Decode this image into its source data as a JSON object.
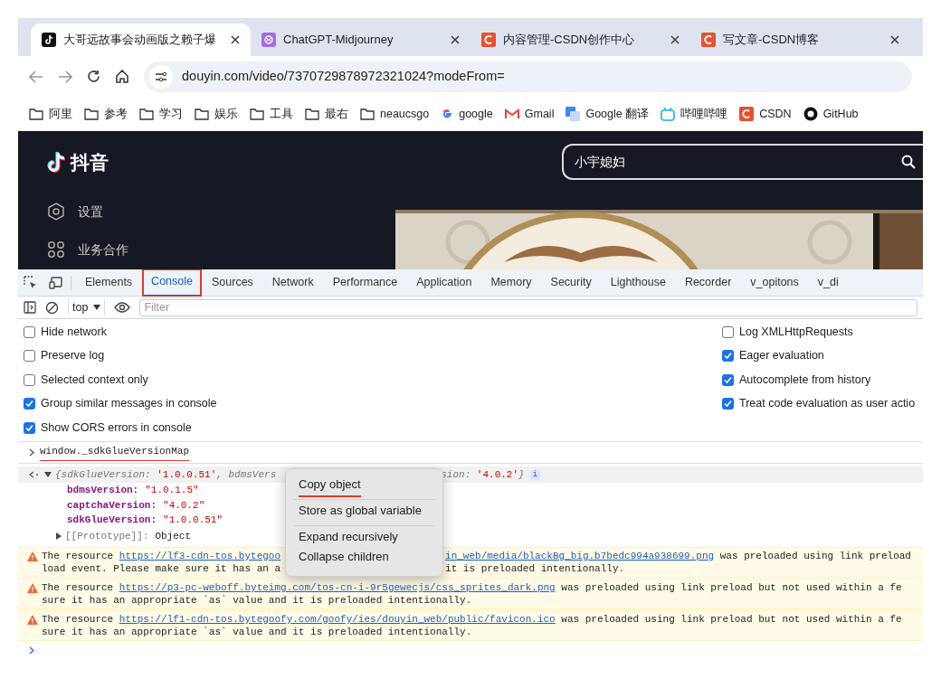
{
  "browser_tabs": [
    {
      "title": "大哥远故事会动画版之赖子爆",
      "kind": "tiktok",
      "selected": true
    },
    {
      "title": "ChatGPT-Midjourney",
      "kind": "chatgpt",
      "selected": false
    },
    {
      "title": "内容管理-CSDN创作中心",
      "kind": "csdn",
      "selected": false
    },
    {
      "title": "写文章-CSDN博客",
      "kind": "csdn",
      "selected": false
    }
  ],
  "address": "douyin.com/video/7370729878972321024?modeFrom=",
  "bookmarks": [
    {
      "label": "阿里",
      "kind": "folder"
    },
    {
      "label": "参考",
      "kind": "folder"
    },
    {
      "label": "学习",
      "kind": "folder"
    },
    {
      "label": "娱乐",
      "kind": "folder"
    },
    {
      "label": "工具",
      "kind": "folder"
    },
    {
      "label": "最右",
      "kind": "folder"
    },
    {
      "label": "neaucsgo",
      "kind": "folder"
    },
    {
      "label": "google",
      "kind": "google"
    },
    {
      "label": "Gmail",
      "kind": "gmail"
    },
    {
      "label": "Google 翻译",
      "kind": "translate"
    },
    {
      "label": "哔哩哔哩",
      "kind": "bilibili"
    },
    {
      "label": "CSDN",
      "kind": "csdn"
    },
    {
      "label": "GitHub",
      "kind": "github"
    }
  ],
  "page": {
    "logo": "抖音",
    "search": {
      "value": "小宇媳妇"
    },
    "sidebar": [
      {
        "label": "设置",
        "kind": "settings"
      },
      {
        "label": "业务合作",
        "kind": "grid"
      }
    ]
  },
  "devtools": {
    "tabs": [
      {
        "label": "Elements",
        "selected": false,
        "marked": false
      },
      {
        "label": "Console",
        "selected": true,
        "marked": true
      },
      {
        "label": "Sources",
        "selected": false,
        "marked": false
      },
      {
        "label": "Network",
        "selected": false,
        "marked": false
      },
      {
        "label": "Performance",
        "selected": false,
        "marked": false
      },
      {
        "label": "Application",
        "selected": false,
        "marked": false
      },
      {
        "label": "Memory",
        "selected": false,
        "marked": false
      },
      {
        "label": "Security",
        "selected": false,
        "marked": false
      },
      {
        "label": "Lighthouse",
        "selected": false,
        "marked": false
      },
      {
        "label": "Recorder",
        "selected": false,
        "marked": false
      },
      {
        "label": "v_opitons",
        "selected": false,
        "marked": false
      },
      {
        "label": "v_di",
        "selected": false,
        "marked": false
      }
    ],
    "context": "top",
    "filter_placeholder": "Filter",
    "settings_left": [
      {
        "label": "Hide network",
        "checked": false
      },
      {
        "label": "Preserve log",
        "checked": false
      },
      {
        "label": "Selected context only",
        "checked": false
      },
      {
        "label": "Group similar messages in console",
        "checked": true
      },
      {
        "label": "Show CORS errors in console",
        "checked": true
      }
    ],
    "settings_right": [
      {
        "label": "Log XMLHttpRequests",
        "checked": false
      },
      {
        "label": "Eager evaluation",
        "checked": true
      },
      {
        "label": "Autocomplete from history",
        "checked": true
      },
      {
        "label": "Treat code evaluation as user actio",
        "checked": true
      }
    ],
    "console": {
      "command": {
        "text": "window._sdkGlueVersionMap",
        "underlined": true
      },
      "preview": [
        {
          "kind": "plain",
          "text": "{sdkGlueVersion: "
        },
        {
          "kind": "string",
          "text": "'1.0.0.51'"
        },
        {
          "kind": "plain",
          "text": ", bdmsVers"
        },
        {
          "kind": "gap"
        },
        {
          "kind": "plain",
          "text": "sion: "
        },
        {
          "kind": "string",
          "text": "'4.0.2'"
        },
        {
          "kind": "plain",
          "text": "}"
        }
      ],
      "info_badge": "i",
      "properties": [
        {
          "key": "bdmsVersion:",
          "value": "\"1.0.1.5\""
        },
        {
          "key": "captchaVersion:",
          "value": "\"4.0.2\""
        },
        {
          "key": "sdkGlueVersion:",
          "value": "\"1.0.0.51\""
        }
      ],
      "prototype": {
        "key": "[[Prototype]]:",
        "value": "Object"
      },
      "warnings": [
        {
          "lines": [
            [
              {
                "kind": "text",
                "text": "The resource "
              },
              {
                "kind": "link",
                "text": "https://lf3-cdn-tos.bytegoo"
              },
              {
                "kind": "gap"
              },
              {
                "kind": "link",
                "text": "in_web/media/blackBg_big.b7bedc994a938699.png"
              },
              {
                "kind": "text",
                "text": " was preloaded using link preload"
              }
            ],
            [
              {
                "kind": "text",
                "text": "load event. Please make sure it has an a"
              },
              {
                "kind": "gap"
              },
              {
                "kind": "text",
                "text": "it is preloaded intentionally."
              }
            ]
          ]
        },
        {
          "lines": [
            [
              {
                "kind": "text",
                "text": "The resource "
              },
              {
                "kind": "link",
                "text": "https://p3-pc-weboff.byteimg.com/tos-cn-i-9r5gewecjs/css_sprites_dark.png"
              },
              {
                "kind": "text",
                "text": " was preloaded using link preload but not used within a fe"
              }
            ],
            [
              {
                "kind": "text",
                "text": "sure it has an appropriate `as` value and it is preloaded intentionally."
              }
            ]
          ]
        },
        {
          "lines": [
            [
              {
                "kind": "text",
                "text": "The resource "
              },
              {
                "kind": "link",
                "text": "https://lf1-cdn-tos.bytegoofy.com/goofy/ies/douyin_web/public/favicon.ico"
              },
              {
                "kind": "text",
                "text": " was preloaded using link preload but not used within a fe"
              }
            ],
            [
              {
                "kind": "text",
                "text": "sure it has an appropriate `as` value and it is preloaded intentionally."
              }
            ]
          ]
        }
      ],
      "context_menu": [
        [
          {
            "label": "Copy object",
            "underlined": true
          }
        ],
        [
          {
            "label": "Store as global variable",
            "underlined": false
          }
        ],
        [
          {
            "label": "Expand recursively",
            "underlined": false
          },
          {
            "label": "Collapse children",
            "underlined": false
          }
        ]
      ]
    }
  }
}
